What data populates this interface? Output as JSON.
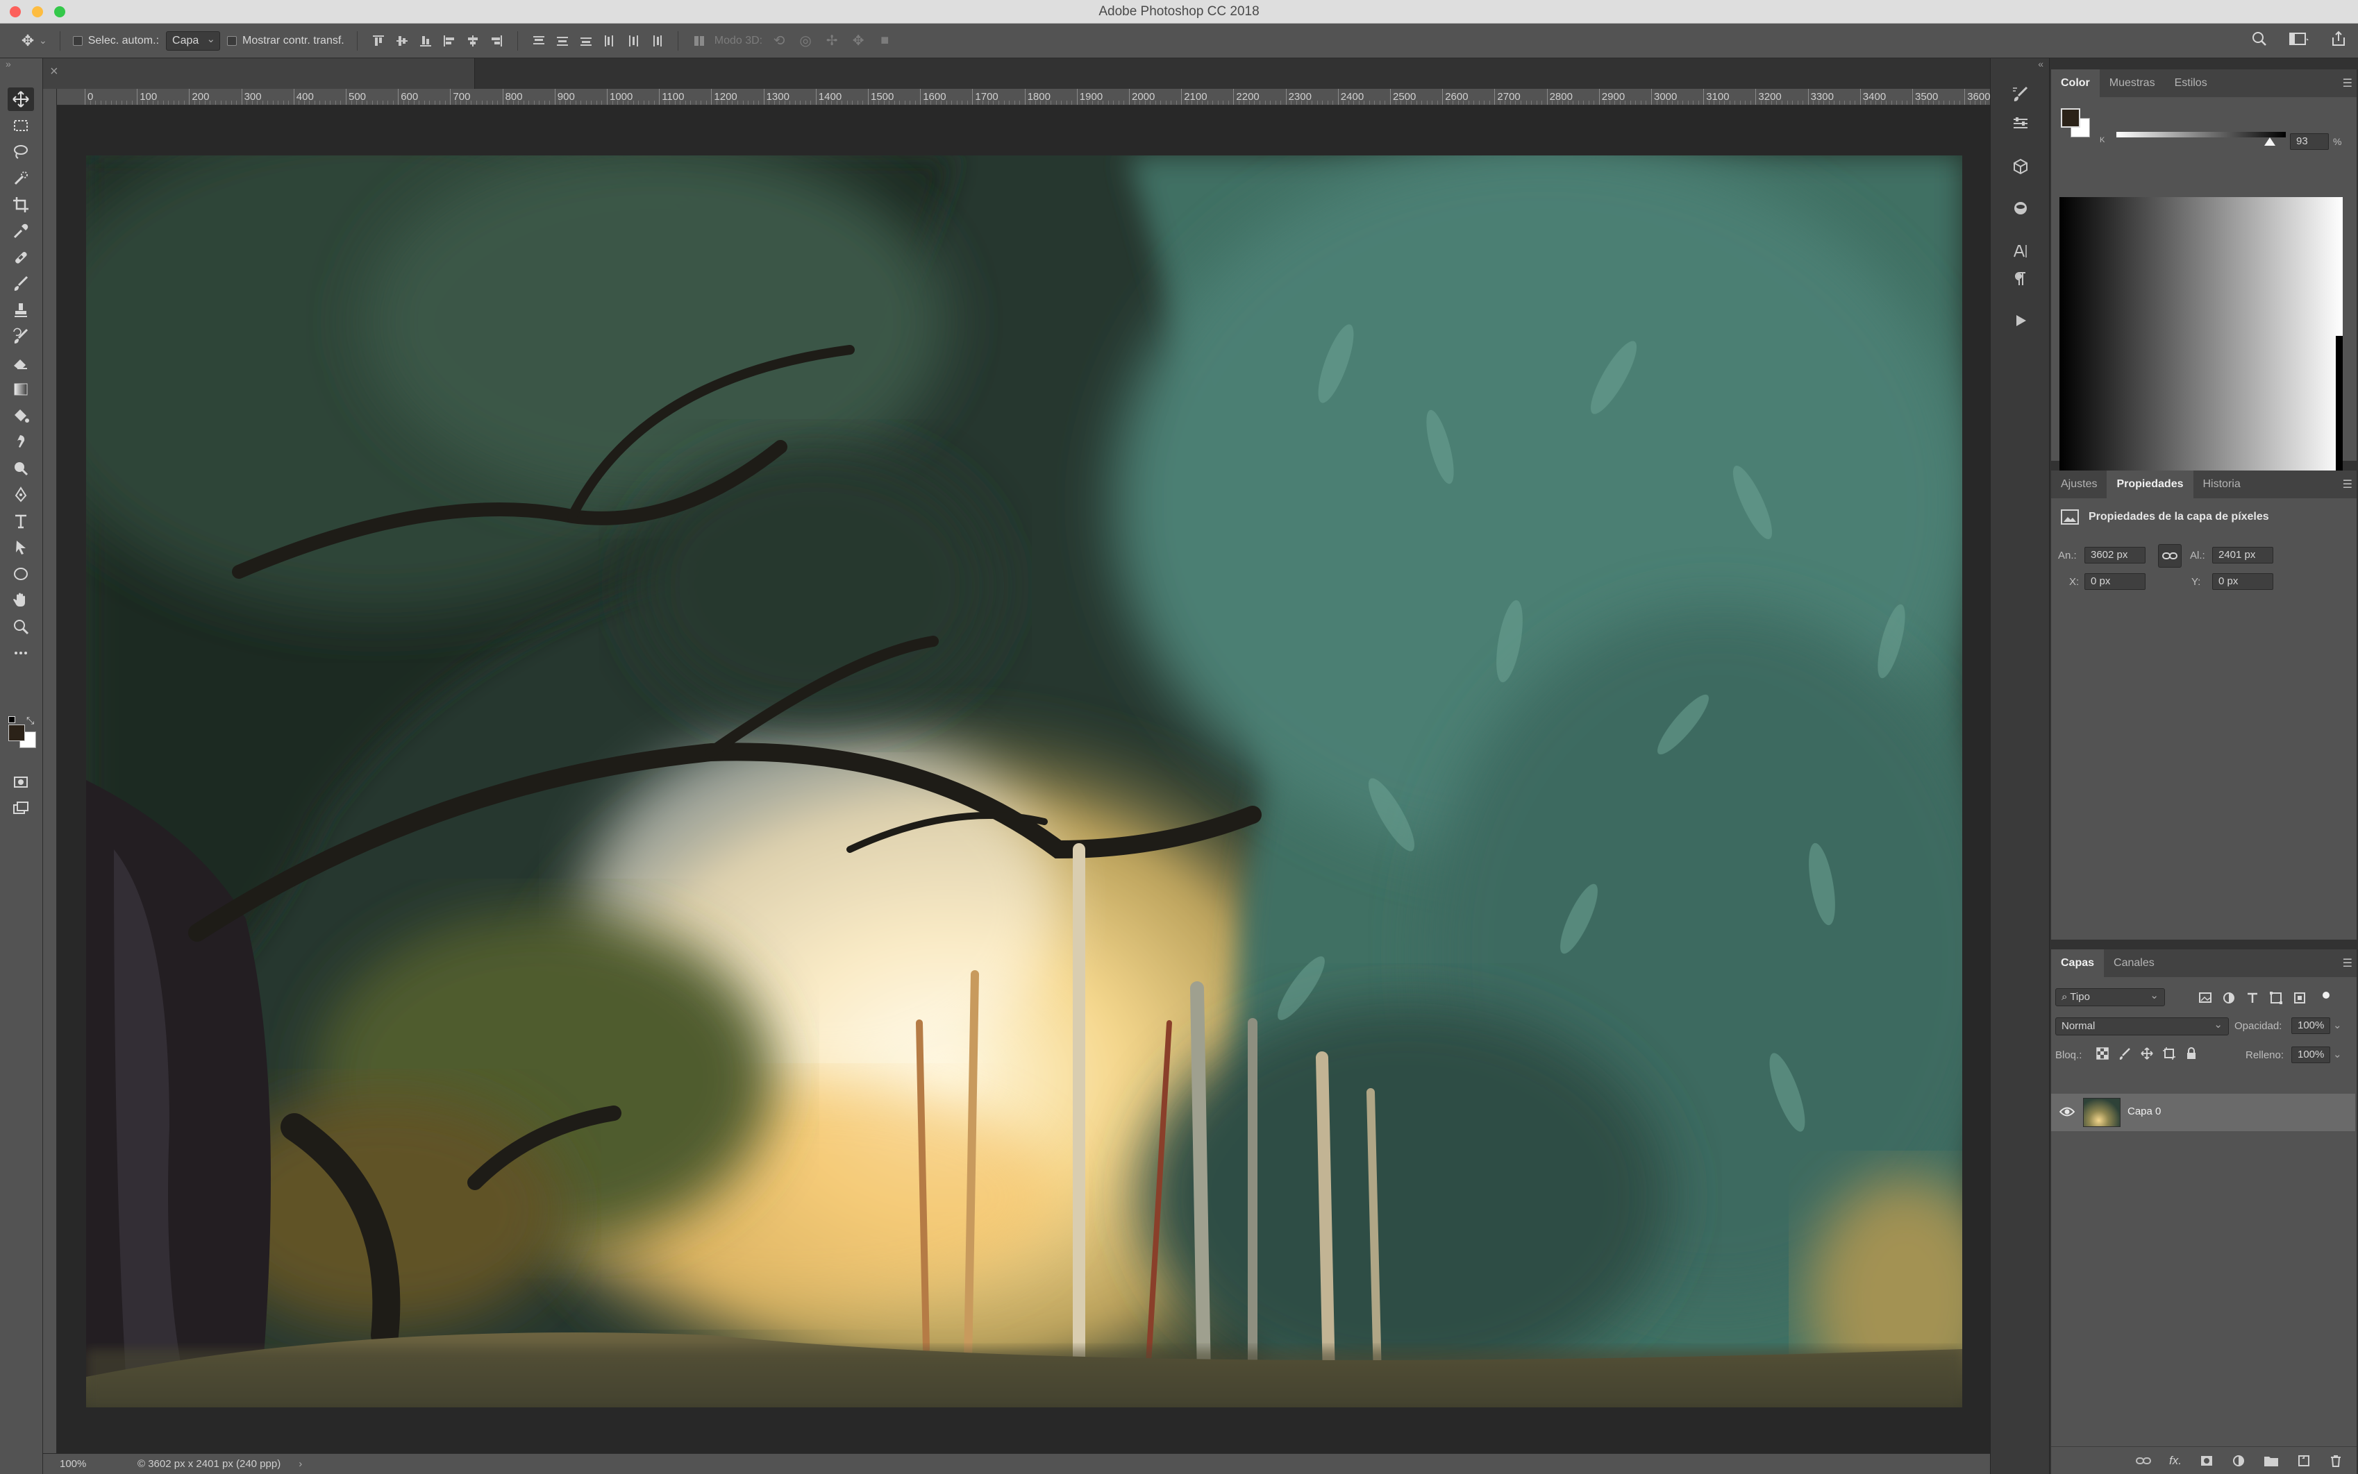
{
  "window": {
    "title": "Adobe Photoshop CC 2018"
  },
  "options_bar": {
    "auto_select_label": "Selec. autom.:",
    "auto_select_target": "Capa",
    "show_transform_label": "Mostrar contr. transf.",
    "mode_3d_label": "Modo 3D:"
  },
  "ruler": {
    "h_labels": [
      "0",
      "100",
      "200",
      "300",
      "400",
      "500",
      "600",
      "700",
      "800",
      "900",
      "1000",
      "1100",
      "1200",
      "1300",
      "1400",
      "1500",
      "1600",
      "1700",
      "1800",
      "1900",
      "2000",
      "2100",
      "2200",
      "2300",
      "2400",
      "2500",
      "2600",
      "2700",
      "2800",
      "2900",
      "3000",
      "3100",
      "3200",
      "3300",
      "3400",
      "3500",
      "3600"
    ]
  },
  "status": {
    "zoom": "100%",
    "info": "© 3602 px x 2401 px (240 ppp)"
  },
  "color_panel": {
    "tabs": [
      "Color",
      "Muestras",
      "Estilos"
    ],
    "slider_label": "K",
    "value": "93",
    "unit": "%",
    "foreground": "#2b2218",
    "background": "#ffffff"
  },
  "properties_panel": {
    "tabs": [
      "Ajustes",
      "Propiedades",
      "Historia"
    ],
    "header": "Propiedades de la capa de píxeles",
    "width_label": "An.:",
    "width_value": "3602 px",
    "height_label": "Al.:",
    "height_value": "2401 px",
    "x_label": "X:",
    "x_value": "0 px",
    "y_label": "Y:",
    "y_value": "0 px"
  },
  "layers_panel": {
    "tabs": [
      "Capas",
      "Canales"
    ],
    "filter": "Tipo",
    "blend_mode": "Normal",
    "opacity_label": "Opacidad:",
    "opacity_value": "100%",
    "lock_label": "Bloq.:",
    "fill_label": "Relleno:",
    "fill_value": "100%",
    "layer_name": "Capa 0"
  },
  "colors": {
    "accent": "#ffffff",
    "panel_bg": "#535353",
    "canvas_bg": "#282828"
  }
}
